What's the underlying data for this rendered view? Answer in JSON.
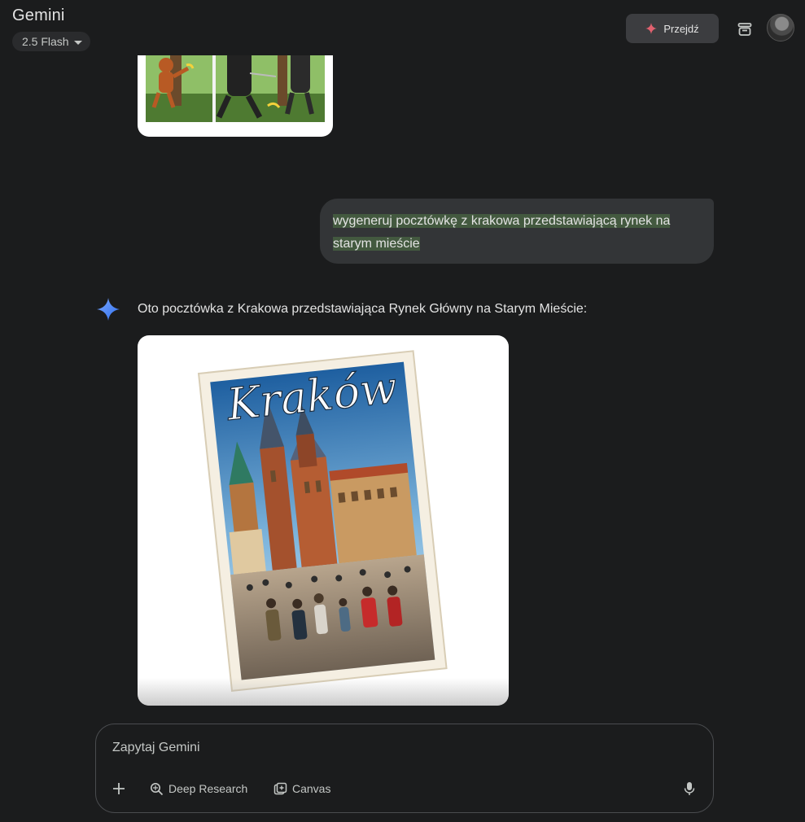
{
  "header": {
    "app_title": "Gemini",
    "model_label": "2.5 Flash",
    "upgrade_label": "Przejdź"
  },
  "conversation": {
    "user_message": {
      "line1": "wygeneruj pocztówkę z krakowa przedstawiającą rynek na",
      "line2": "starym mieście"
    },
    "assistant_message": {
      "text": "Oto pocztówka z Krakowa przedstawiająca Rynek Główny na Starym Mieście:",
      "postcard_title": "Kraków"
    }
  },
  "composer": {
    "placeholder": "Zapytaj Gemini",
    "tools": [
      "Deep Research",
      "Canvas"
    ]
  },
  "colors": {
    "background": "#1b1c1d",
    "bubble": "#333537",
    "highlight": "#43593f",
    "accent": "#4c8df6"
  }
}
